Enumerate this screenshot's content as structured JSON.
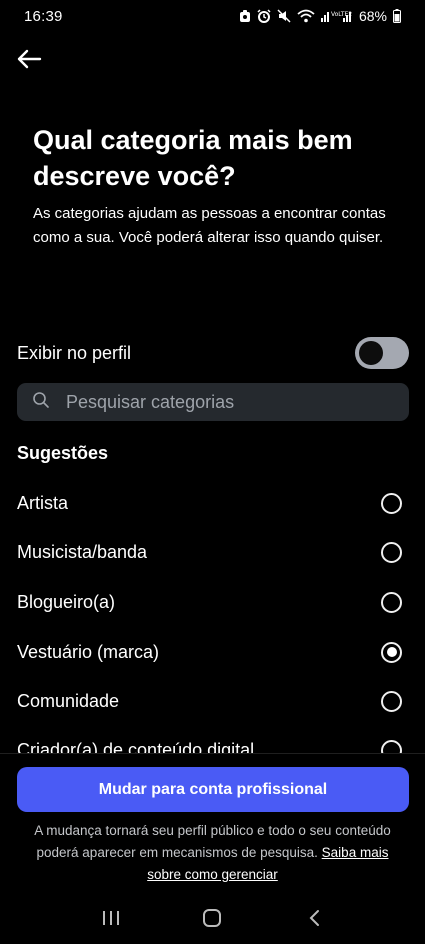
{
  "status_bar": {
    "time": "16:39",
    "battery": "68%",
    "icons": [
      "app-icon",
      "alarm-icon",
      "mute-icon",
      "wifi-icon",
      "signal-icon",
      "battery-icon"
    ]
  },
  "header": {
    "back_icon": "arrow-left-icon"
  },
  "main": {
    "title": "Qual categoria mais bem descreve você?",
    "subtitle": "As categorias ajudam as pessoas a encontrar contas como a sua. Você poderá alterar isso quando quiser."
  },
  "toggle": {
    "label": "Exibir no perfil",
    "on": false
  },
  "search": {
    "placeholder": "Pesquisar categorias",
    "value": ""
  },
  "suggestions": {
    "title": "Sugestões",
    "items": [
      {
        "label": "Artista",
        "selected": false
      },
      {
        "label": "Musicista/banda",
        "selected": false
      },
      {
        "label": "Blogueiro(a)",
        "selected": false
      },
      {
        "label": "Vestuário (marca)",
        "selected": true
      },
      {
        "label": "Comunidade",
        "selected": false
      },
      {
        "label": "Criador(a) de conteúdo digital",
        "selected": false
      }
    ]
  },
  "cta": {
    "label": "Mudar para conta profissional"
  },
  "footer": {
    "text": "A mudança tornará seu perfil público e todo o seu conteúdo poderá aparecer em mecanismos de pesquisa. ",
    "link": "Saiba mais sobre como gerenciar"
  },
  "colors": {
    "accent": "#4a5bf5",
    "background": "#000000",
    "search_bg": "#25292e"
  }
}
